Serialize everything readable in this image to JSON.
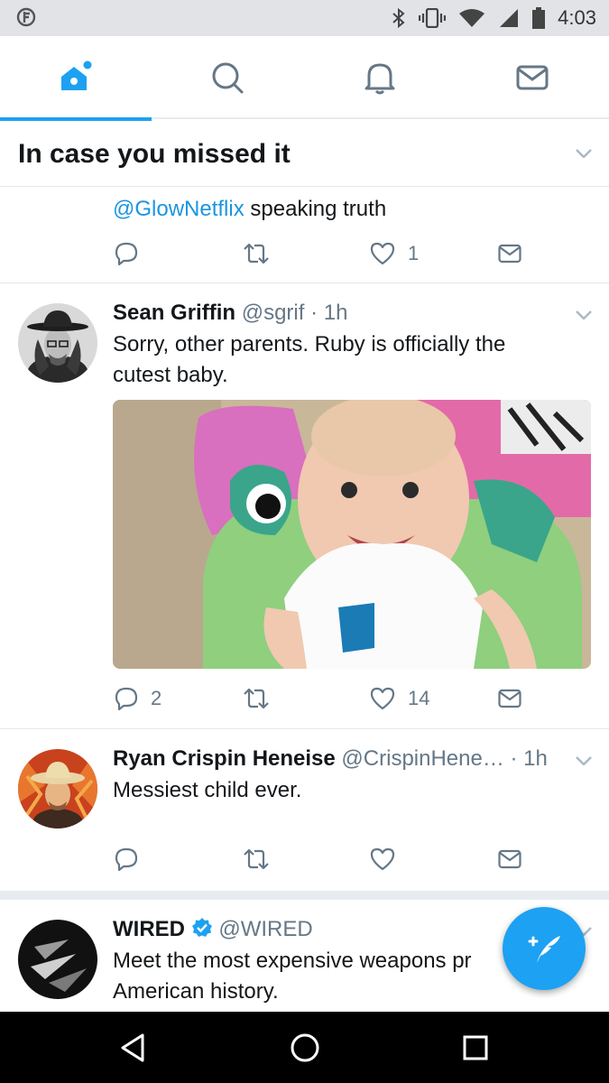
{
  "status_bar": {
    "time": "4:03",
    "icons": [
      "app-notification-icon",
      "bluetooth-icon",
      "vibrate-icon",
      "wifi-icon",
      "signal-icon",
      "battery-icon"
    ]
  },
  "tabs": [
    {
      "name": "home",
      "icon": "home-icon",
      "active": true
    },
    {
      "name": "search",
      "icon": "search-icon",
      "active": false
    },
    {
      "name": "notifications",
      "icon": "bell-icon",
      "active": false
    },
    {
      "name": "messages",
      "icon": "mail-icon",
      "active": false
    }
  ],
  "section": {
    "title": "In case you missed it"
  },
  "tweets": [
    {
      "mention": "@GlowNetflix",
      "text": " speaking truth",
      "replies": "",
      "retweets": "",
      "likes": "1"
    },
    {
      "name": "Sean Griffin",
      "handle": "@sgrif",
      "time": "· 1h",
      "text": "Sorry, other parents. Ruby is officially the cutest baby.",
      "replies": "2",
      "retweets": "",
      "likes": "14"
    },
    {
      "name": "Ryan Crispin Heneise",
      "handle": "@CrispinHene…",
      "time": "· 1h",
      "text": "Messiest child ever.",
      "replies": "",
      "retweets": "",
      "likes": ""
    },
    {
      "name": "WIRED",
      "handle": "@WIRED",
      "verified": true,
      "text_line1": "Meet the most expensive weapons pr",
      "text_line2": "American history."
    }
  ],
  "colors": {
    "accent": "#1da1f2",
    "link": "#1b95e0",
    "secondary_text": "#657786",
    "divider": "#e1e8ed"
  }
}
